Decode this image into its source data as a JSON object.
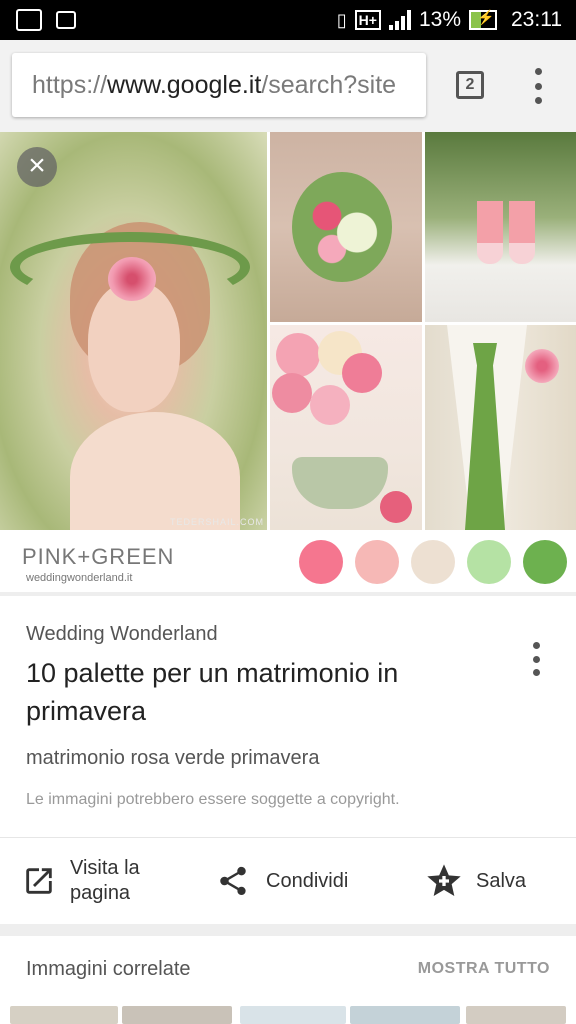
{
  "status_bar": {
    "battery": "13%",
    "time": "23:11",
    "network": "H+"
  },
  "browser": {
    "url_scheme": "https://",
    "url_host": "www.google.it",
    "url_path": "/search?site",
    "tab_count": "2"
  },
  "image": {
    "close_label": "×",
    "brand_text": "PINK+GREEN",
    "brand_url": "weddingwonderland.it",
    "watermark": "TEDERSHAIL.COM",
    "palette": [
      "#f5768f",
      "#f6b8b6",
      "#ede0d2",
      "#b5e2a4",
      "#6db14f"
    ]
  },
  "result": {
    "source": "Wedding Wonderland",
    "title": "10 palette per un matrimonio in primavera",
    "query": "matrimonio rosa verde primavera",
    "copyright": "Le immagini potrebbero essere soggette a copyright."
  },
  "actions": {
    "visit_label": "Visita la pagina",
    "share_label": "Condividi",
    "save_label": "Salva"
  },
  "related": {
    "title": "Immagini correlate",
    "show_all": "MOSTRA TUTTO"
  }
}
